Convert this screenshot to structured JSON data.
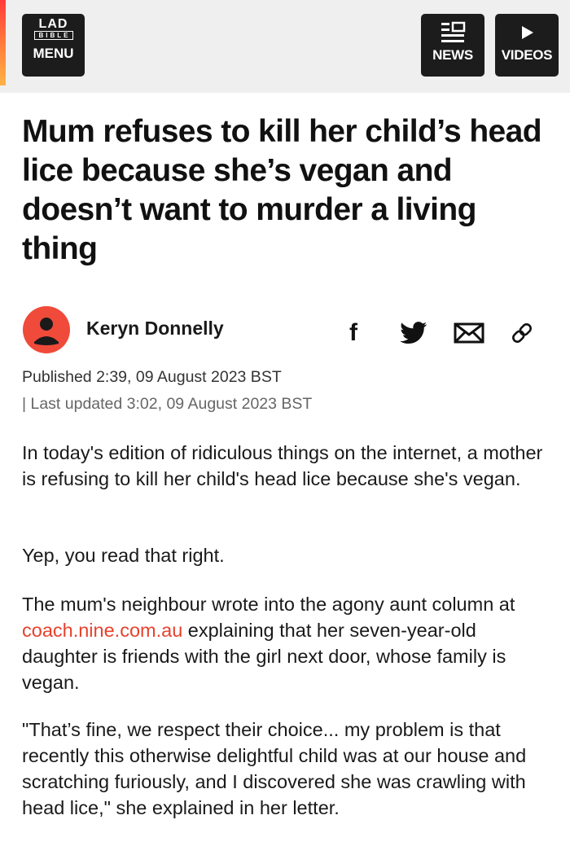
{
  "header": {
    "logo_top": "LAD",
    "logo_sub": "BIBLE",
    "menu_label": "MENU",
    "news_label": "NEWS",
    "videos_label": "VIDEOS",
    "accent_color": "#f04a3b"
  },
  "article": {
    "headline": "Mum refuses to kill her child’s head lice because she’s vegan and doesn’t want to murder a living thing",
    "author": "Keryn Donnelly",
    "published": "Published 2:39, 09 August 2023 BST",
    "updated": "| Last updated 3:02, 09 August 2023 BST",
    "share_icons": [
      "facebook-icon",
      "twitter-icon",
      "email-icon",
      "link-icon"
    ],
    "paragraphs": {
      "p1": "In today's edition of ridiculous things on the internet, a mother is refusing to kill her child's head lice because she's vegan.",
      "p2": "Yep, you read that right.",
      "p3_before": "The mum's neighbour wrote into the agony aunt column at ",
      "p3_link": "coach.nine.com.au",
      "p3_after": " explaining that her seven-year-old daughter is friends with the girl next door, whose family is vegan.",
      "p4": "\"That’s fine, we respect their choice... my problem is that recently this otherwise delightful child was at our house and scratching furiously, and I discovered she was crawling with head lice,\" she explained in her letter."
    },
    "link_color": "#e8412c"
  }
}
